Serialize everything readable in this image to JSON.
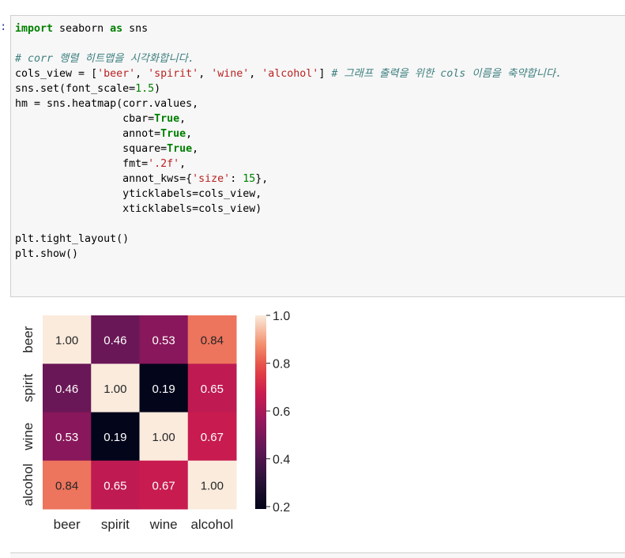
{
  "prompt": ":",
  "code_lines": [
    [
      {
        "t": "import",
        "c": "kw"
      },
      {
        "t": " seaborn "
      },
      {
        "t": "as",
        "c": "kw"
      },
      {
        "t": " sns"
      }
    ],
    [],
    [
      {
        "t": "# corr 행렬 히트맵을 시각화합니다.",
        "c": "cm"
      }
    ],
    [
      {
        "t": "cols_view = ["
      },
      {
        "t": "'beer'",
        "c": "str"
      },
      {
        "t": ", "
      },
      {
        "t": "'spirit'",
        "c": "str"
      },
      {
        "t": ", "
      },
      {
        "t": "'wine'",
        "c": "str"
      },
      {
        "t": ", "
      },
      {
        "t": "'alcohol'",
        "c": "str"
      },
      {
        "t": "] "
      },
      {
        "t": "# 그래프 출력을 위한 cols 이름을 축약합니다.",
        "c": "cm"
      }
    ],
    [
      {
        "t": "sns.set(font_scale="
      },
      {
        "t": "1.5",
        "c": "num"
      },
      {
        "t": ")"
      }
    ],
    [
      {
        "t": "hm = sns.heatmap(corr.values,"
      }
    ],
    [
      {
        "t": "                 cbar="
      },
      {
        "t": "True",
        "c": "kw"
      },
      {
        "t": ","
      }
    ],
    [
      {
        "t": "                 annot="
      },
      {
        "t": "True",
        "c": "kw"
      },
      {
        "t": ","
      }
    ],
    [
      {
        "t": "                 square="
      },
      {
        "t": "True",
        "c": "kw"
      },
      {
        "t": ","
      }
    ],
    [
      {
        "t": "                 fmt="
      },
      {
        "t": "'.2f'",
        "c": "str"
      },
      {
        "t": ","
      }
    ],
    [
      {
        "t": "                 annot_kws={"
      },
      {
        "t": "'size'",
        "c": "str"
      },
      {
        "t": ": "
      },
      {
        "t": "15",
        "c": "num"
      },
      {
        "t": "},"
      }
    ],
    [
      {
        "t": "                 yticklabels=cols_view,"
      }
    ],
    [
      {
        "t": "                 xticklabels=cols_view)"
      }
    ],
    [],
    [
      {
        "t": "plt.tight_layout()"
      }
    ],
    [
      {
        "t": "plt.show()"
      }
    ]
  ],
  "chart_data": {
    "type": "heatmap",
    "x_labels": [
      "beer",
      "spirit",
      "wine",
      "alcohol"
    ],
    "y_labels": [
      "beer",
      "spirit",
      "wine",
      "alcohol"
    ],
    "values": [
      [
        1.0,
        0.46,
        0.53,
        0.84
      ],
      [
        0.46,
        1.0,
        0.19,
        0.65
      ],
      [
        0.53,
        0.19,
        1.0,
        0.67
      ],
      [
        0.84,
        0.65,
        0.67,
        1.0
      ]
    ],
    "annotation_format": ".2f",
    "colormap": "rocket",
    "colorbar": {
      "min": 0.19,
      "max": 1.0,
      "ticks": [
        0.2,
        0.4,
        0.6,
        0.8,
        1.0
      ],
      "tick_labels": [
        "0.2",
        "0.4",
        "0.6",
        "0.8",
        "1.0"
      ]
    }
  }
}
